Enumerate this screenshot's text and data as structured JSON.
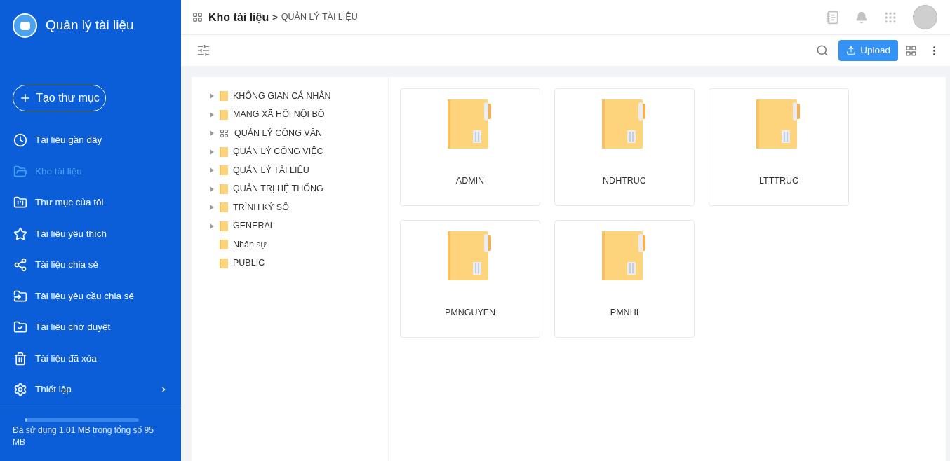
{
  "app": {
    "title": "Quản lý tài liệu"
  },
  "create_button": {
    "label": "Tạo thư mục"
  },
  "nav": [
    {
      "label": "Tài liệu gần đây",
      "selected": false,
      "submenu": false
    },
    {
      "label": "Kho tài liệu",
      "selected": true,
      "submenu": false
    },
    {
      "label": "Thư mục của tôi",
      "selected": false,
      "submenu": false
    },
    {
      "label": "Tài liệu yêu thích",
      "selected": false,
      "submenu": false
    },
    {
      "label": "Tài liệu chia sẻ",
      "selected": false,
      "submenu": false
    },
    {
      "label": "Tài liệu yêu cầu chia sẻ",
      "selected": false,
      "submenu": false
    },
    {
      "label": "Tài liệu chờ duyệt",
      "selected": false,
      "submenu": false
    },
    {
      "label": "Tài liệu đã xóa",
      "selected": false,
      "submenu": false
    },
    {
      "label": "Thiết lập",
      "selected": false,
      "submenu": true
    }
  ],
  "storage": {
    "level": 0.01,
    "text": "Đã sử dụng 1.01 MB trong tổng số 95 MB"
  },
  "breadcrumb": {
    "root": "Kho tài liệu",
    "separator": ">",
    "current": "QUẢN LÝ TÀI LIỆU"
  },
  "toolbar": {
    "upload": "Upload"
  },
  "tree": [
    {
      "label": "KHÔNG GIAN CÁ NHÂN",
      "kind": "folder",
      "expandable": true
    },
    {
      "label": "MẠNG XÃ HỘI NỘI BỘ",
      "kind": "folder",
      "expandable": true
    },
    {
      "label": "QUẢN LÝ CÔNG VĂN",
      "kind": "module",
      "expandable": true
    },
    {
      "label": "QUẢN LÝ CÔNG VIỆC",
      "kind": "folder",
      "expandable": true
    },
    {
      "label": "QUẢN LÝ TÀI LIỆU",
      "kind": "folder",
      "expandable": true
    },
    {
      "label": "QUẢN TRỊ HỆ THỐNG",
      "kind": "folder",
      "expandable": true
    },
    {
      "label": "TRÌNH KÝ SỐ",
      "kind": "folder",
      "expandable": true
    },
    {
      "label": "GENERAL",
      "kind": "folder",
      "expandable": true
    },
    {
      "label": "Nhân sự",
      "kind": "folder",
      "expandable": false
    },
    {
      "label": "PUBLIC",
      "kind": "folder",
      "expandable": false
    }
  ],
  "folders": [
    {
      "name": "ADMIN"
    },
    {
      "name": "NDHTRUC"
    },
    {
      "name": "LTTTRUC"
    },
    {
      "name": "PMNGUYEN"
    },
    {
      "name": "PMNHI"
    }
  ]
}
